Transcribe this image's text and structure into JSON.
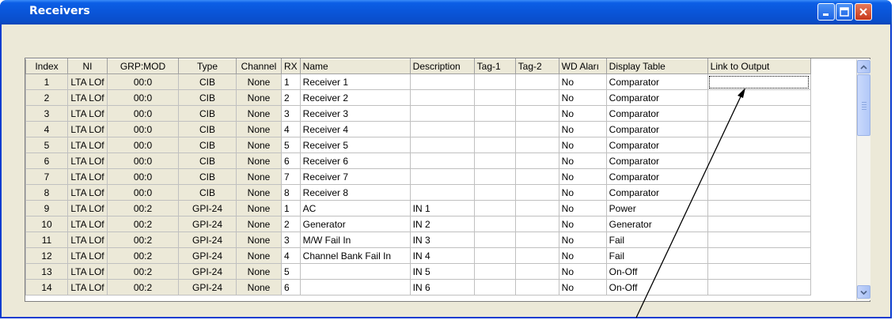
{
  "window": {
    "title": "Receivers",
    "accent": "#0a55d8",
    "buttons": [
      {
        "name": "minimize-icon"
      },
      {
        "name": "maximize-icon"
      },
      {
        "name": "close-icon"
      }
    ]
  },
  "grid": {
    "columns": [
      "Index",
      "NI",
      "GRP:MOD",
      "Type",
      "Channel",
      "RX",
      "Name",
      "Description",
      "Tag-1",
      "Tag-2",
      "WD Aları",
      "Display Table",
      "Link to Output"
    ],
    "rows": [
      [
        "1",
        "LTA LOf",
        "00:0",
        "CIB",
        "None",
        "1",
        "Receiver 1",
        "",
        "",
        "",
        "No",
        "Comparator",
        ""
      ],
      [
        "2",
        "LTA LOf",
        "00:0",
        "CIB",
        "None",
        "2",
        "Receiver 2",
        "",
        "",
        "",
        "No",
        "Comparator",
        ""
      ],
      [
        "3",
        "LTA LOf",
        "00:0",
        "CIB",
        "None",
        "3",
        "Receiver 3",
        "",
        "",
        "",
        "No",
        "Comparator",
        ""
      ],
      [
        "4",
        "LTA LOf",
        "00:0",
        "CIB",
        "None",
        "4",
        "Receiver 4",
        "",
        "",
        "",
        "No",
        "Comparator",
        ""
      ],
      [
        "5",
        "LTA LOf",
        "00:0",
        "CIB",
        "None",
        "5",
        "Receiver 5",
        "",
        "",
        "",
        "No",
        "Comparator",
        ""
      ],
      [
        "6",
        "LTA LOf",
        "00:0",
        "CIB",
        "None",
        "6",
        "Receiver 6",
        "",
        "",
        "",
        "No",
        "Comparator",
        ""
      ],
      [
        "7",
        "LTA LOf",
        "00:0",
        "CIB",
        "None",
        "7",
        "Receiver 7",
        "",
        "",
        "",
        "No",
        "Comparator",
        ""
      ],
      [
        "8",
        "LTA LOf",
        "00:0",
        "CIB",
        "None",
        "8",
        "Receiver 8",
        "",
        "",
        "",
        "No",
        "Comparator",
        ""
      ],
      [
        "9",
        "LTA LOf",
        "00:2",
        "GPI-24",
        "None",
        "1",
        "AC",
        "IN 1",
        "",
        "",
        "No",
        "Power",
        ""
      ],
      [
        "10",
        "LTA LOf",
        "00:2",
        "GPI-24",
        "None",
        "2",
        "Generator",
        "IN 2",
        "",
        "",
        "No",
        "Generator",
        ""
      ],
      [
        "11",
        "LTA LOf",
        "00:2",
        "GPI-24",
        "None",
        "3",
        "M/W Fail In",
        "IN 3",
        "",
        "",
        "No",
        "Fail",
        ""
      ],
      [
        "12",
        "LTA LOf",
        "00:2",
        "GPI-24",
        "None",
        "4",
        "Channel Bank Fail In",
        "IN 4",
        "",
        "",
        "No",
        "Fail",
        ""
      ],
      [
        "13",
        "LTA LOf",
        "00:2",
        "GPI-24",
        "None",
        "5",
        "",
        "IN 5",
        "",
        "",
        "No",
        "On-Off",
        ""
      ],
      [
        "14",
        "LTA LOf",
        "00:2",
        "GPI-24",
        "None",
        "6",
        "",
        "IN 6",
        "",
        "",
        "No",
        "On-Off",
        ""
      ]
    ]
  },
  "scrollbar": {
    "up": "up-arrow-icon",
    "down": "down-arrow-icon"
  }
}
